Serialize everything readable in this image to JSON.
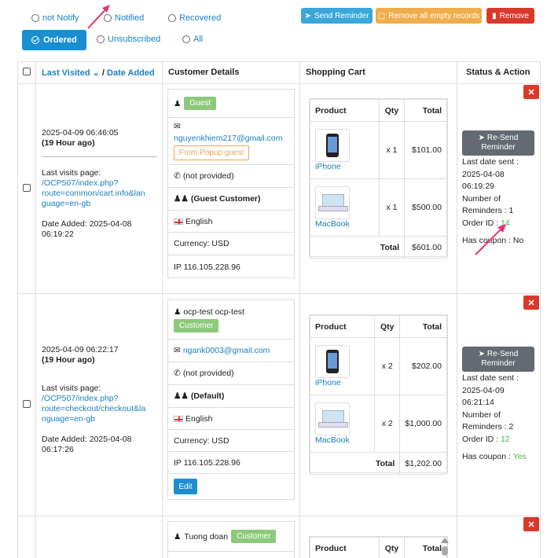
{
  "filters": {
    "not_notify": "not Notify",
    "notified": "Notified",
    "recovered": "Recovered",
    "ordered": "Ordered",
    "unsubscribed": "Unsubscribed",
    "all": "All"
  },
  "toolbar": {
    "send_reminder": "Send Reminder",
    "remove_empty": "Remove all empty records",
    "remove": "Remove"
  },
  "table": {
    "headers": {
      "last_visited": "Last Visited",
      "slash": "/",
      "date_added": "Date Added",
      "customer_details": "Customer Details",
      "shopping_cart": "Shopping Cart",
      "status_action": "Status & Action"
    },
    "cart_headers": {
      "product": "Product",
      "qty": "Qty",
      "total": "Total"
    }
  },
  "rows": [
    {
      "visited": "2025-04-09 06:46:05",
      "ago": "(19 Hour ago)",
      "last_visits_label": "Last visits page:",
      "page_url_1": "/OCP507/index.php?",
      "page_url_2": "route=common/cart.info&lan",
      "page_url_3": "guage=en-gb",
      "date_added_1": "Date Added: 2025-04-08",
      "date_added_2": "06:19:22",
      "customer_name": "",
      "customer_badge": "Guest",
      "email": "nguyenkhiem217@gmail.com",
      "source_badge": "From Popup guest",
      "phone": "(not provided)",
      "group": "(Guest Customer)",
      "language": "English",
      "currency": "Currency: USD",
      "ip": "IP 116.105.228.96",
      "items": [
        {
          "name": "iPhone",
          "qty": "x 1",
          "total": "$101.00"
        },
        {
          "name": "MacBook",
          "qty": "x 1",
          "total": "$500.00"
        }
      ],
      "cart_total_label": "Total",
      "cart_total": "$601.00",
      "resend": "Re-Send Reminder",
      "last_sent_label": "Last date sent :",
      "last_sent_date": "2025-04-08",
      "last_sent_time": "06:19:29",
      "reminders_label": "Number of",
      "reminders_value": "Reminders : 1",
      "order_label": "Order ID :",
      "order_id": "14",
      "coupon_label": "Has coupon :",
      "coupon": "No"
    },
    {
      "visited": "2025-04-09 06:22:17",
      "ago": "(19 Hour ago)",
      "last_visits_label": "Last visits page:",
      "page_url_1": "/OCP507/index.php?",
      "page_url_2": "route=checkout/checkout&la",
      "page_url_3": "nguage=en-gb",
      "date_added_1": "Date Added: 2025-04-08",
      "date_added_2": "06:17:26",
      "customer_name": "ocp-test ocp-test",
      "customer_badge": "Customer",
      "email": "ngank0003@gmail.com",
      "phone": "(not provided)",
      "group": "(Default)",
      "language": "English",
      "currency": "Currency: USD",
      "ip": "IP 116.105.228.96",
      "edit": "Edit",
      "items": [
        {
          "name": "iPhone",
          "qty": "x 2",
          "total": "$202.00"
        },
        {
          "name": "MacBook",
          "qty": "x 2",
          "total": "$1,000.00"
        }
      ],
      "cart_total_label": "Total",
      "cart_total": "$1,202.00",
      "resend": "Re-Send Reminder",
      "last_sent_label": "Last date sent :",
      "last_sent_date": "2025-04-09",
      "last_sent_time": "06:21:14",
      "reminders_label": "Number of",
      "reminders_value": "Reminders : 2",
      "order_label": "Order ID :",
      "order_id": "12",
      "coupon_label": "Has coupon :",
      "coupon": "Yes"
    },
    {
      "customer_name": "Tuong doan",
      "customer_badge": "Customer"
    }
  ],
  "colors": {
    "primary": "#1a8fd0",
    "warning": "#f0ad4e",
    "danger": "#d9392b",
    "success": "#4caf50",
    "annotation": "#e5317b"
  }
}
